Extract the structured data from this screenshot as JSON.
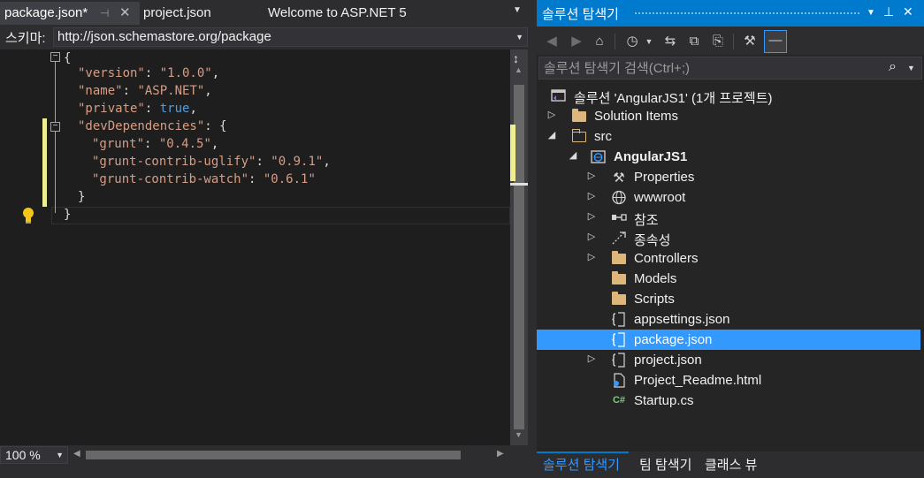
{
  "editor": {
    "tabs": [
      {
        "label": "package.json*",
        "active": true,
        "pin_icon": "pin-icon",
        "close_icon": "close-icon"
      },
      {
        "label": "project.json",
        "active": false
      },
      {
        "label": "Welcome to ASP.NET 5",
        "active": false
      }
    ],
    "schema": {
      "label": "스키마:",
      "value": "http://json.schemastore.org/package"
    },
    "code": {
      "line1": "{",
      "version_key": "\"version\"",
      "version_val": "\"1.0.0\"",
      "name_key": "\"name\"",
      "name_val": "\"ASP.NET\"",
      "private_key": "\"private\"",
      "private_val": "true",
      "dev_key": "\"devDependencies\"",
      "grunt_key": "\"grunt\"",
      "grunt_val": "\"0.4.5\"",
      "uglify_key": "\"grunt-contrib-uglify\"",
      "uglify_val": "\"0.9.1\"",
      "watch_key": "\"grunt-contrib-watch\"",
      "watch_val": "\"0.6.1\"",
      "inner_close": "}",
      "outer_close": "}",
      "colon": ": ",
      "comma": ",",
      "open_brace": "{"
    },
    "zoom": "100 %"
  },
  "solution_explorer": {
    "title": "솔루션 탐색기",
    "title_buttons": [
      "dropdown-icon",
      "pin-icon",
      "close-icon"
    ],
    "search_placeholder": "솔루션 탐색기 검색(Ctrl+;)",
    "tree": [
      {
        "label": "솔루션 'AngularJS1' (1개 프로젝트)",
        "icon": "solution-icon",
        "level": 0,
        "expander": "none"
      },
      {
        "label": "Solution Items",
        "icon": "folder-icon",
        "level": 0,
        "expander": "collapsed"
      },
      {
        "label": "src",
        "icon": "folder-open-icon",
        "level": 0,
        "expander": "expanded"
      },
      {
        "label": "AngularJS1",
        "icon": "web-project-icon",
        "level": 1,
        "expander": "expanded",
        "bold": true
      },
      {
        "label": "Properties",
        "icon": "wrench-icon",
        "level": 2,
        "expander": "collapsed"
      },
      {
        "label": "wwwroot",
        "icon": "globe-icon",
        "level": 2,
        "expander": "collapsed"
      },
      {
        "label": "참조",
        "icon": "references-icon",
        "level": 2,
        "expander": "collapsed"
      },
      {
        "label": "종속성",
        "icon": "dependencies-icon",
        "level": 2,
        "expander": "collapsed"
      },
      {
        "label": "Controllers",
        "icon": "folder-icon",
        "level": 2,
        "expander": "collapsed"
      },
      {
        "label": "Models",
        "icon": "folder-icon",
        "level": 2,
        "expander": "none"
      },
      {
        "label": "Scripts",
        "icon": "folder-icon",
        "level": 2,
        "expander": "none"
      },
      {
        "label": "appsettings.json",
        "icon": "json-file-icon",
        "level": 2,
        "expander": "none"
      },
      {
        "label": "package.json",
        "icon": "json-file-icon",
        "level": 2,
        "expander": "none",
        "selected": true
      },
      {
        "label": "project.json",
        "icon": "json-file-icon",
        "level": 2,
        "expander": "collapsed"
      },
      {
        "label": "Project_Readme.html",
        "icon": "html-file-icon",
        "level": 2,
        "expander": "none"
      },
      {
        "label": "Startup.cs",
        "icon": "csharp-file-icon",
        "level": 2,
        "expander": "none"
      }
    ],
    "bottom_tabs": [
      "솔루션 탐색기",
      "팀 탐색기",
      "클래스 뷰"
    ]
  },
  "colors": {
    "accent": "#007acc",
    "selection": "#3399ff",
    "json_key": "#d69d85",
    "json_keyword": "#569cd6",
    "folder": "#dcb67a",
    "changed_marker": "#efef91"
  }
}
